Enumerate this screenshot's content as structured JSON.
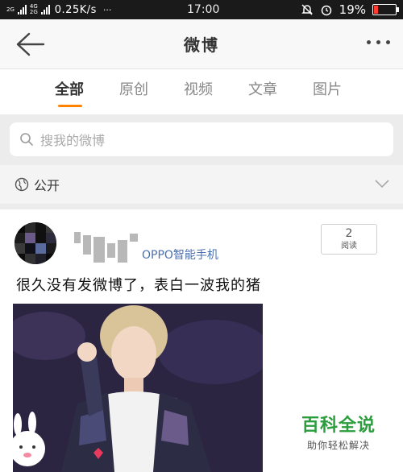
{
  "status_bar": {
    "signal_label": "2G",
    "network_top": "4G",
    "network_bottom": "2G",
    "speed": "0.25K/s",
    "more": "···",
    "time": "17:00",
    "battery_percent": "19%",
    "battery_level": 0.19,
    "battery_color": "#ff3b30"
  },
  "header": {
    "title": "微博",
    "back_icon": "arrow-left-icon",
    "more_icon": "more-dots-icon"
  },
  "tabs": [
    {
      "label": "全部",
      "active": true
    },
    {
      "label": "原创",
      "active": false
    },
    {
      "label": "视频",
      "active": false
    },
    {
      "label": "文章",
      "active": false
    },
    {
      "label": "图片",
      "active": false
    }
  ],
  "accent_color": "#ff8200",
  "search": {
    "placeholder": "搜我的微博",
    "icon": "search-icon"
  },
  "visibility": {
    "label": "公开",
    "icon": "globe-icon",
    "chevron": "chevron-down-icon"
  },
  "post": {
    "source": "OPPO智能手机",
    "read_count": "2",
    "read_label": "阅读",
    "text": "很久没有发微博了，表白一波我的猪"
  },
  "watermark": {
    "main": "百科全说",
    "sub": "助你轻松解决"
  }
}
